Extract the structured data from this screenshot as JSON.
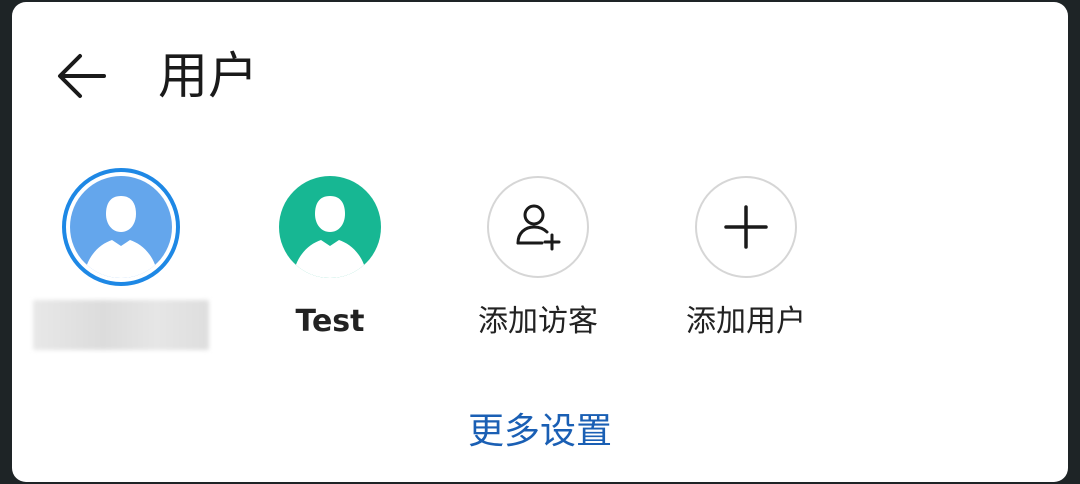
{
  "header": {
    "back_icon": "arrow-left-icon",
    "title": "用户"
  },
  "users": [
    {
      "name": "",
      "type": "current-user",
      "avatar_color": "#64a6ec",
      "name_blurred": true
    },
    {
      "name": "Test",
      "type": "user",
      "avatar_color": "#17b793"
    },
    {
      "name": "添加访客",
      "type": "add-guest",
      "icon": "add-person-icon"
    },
    {
      "name": "添加用户",
      "type": "add-user",
      "icon": "plus-icon"
    }
  ],
  "footer": {
    "more_settings": "更多设置"
  },
  "colors": {
    "accent": "#1a5fb4",
    "selected_ring": "#1e88e5"
  }
}
